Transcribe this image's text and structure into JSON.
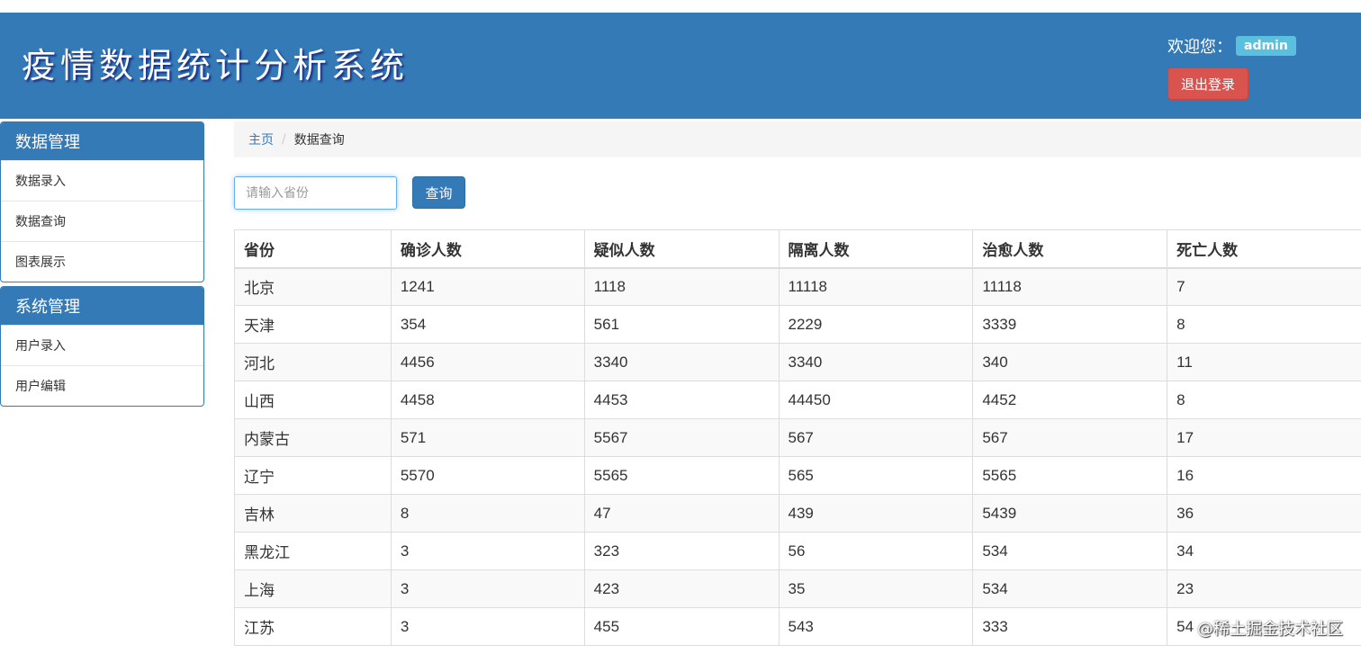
{
  "header": {
    "title": "疫情数据统计分析系统",
    "welcome_label": "欢迎您：",
    "username": "admin",
    "logout_label": "退出登录"
  },
  "sidebar": {
    "data_panel": {
      "title": "数据管理",
      "items": [
        "数据录入",
        "数据查询",
        "图表展示"
      ]
    },
    "system_panel": {
      "title": "系统管理",
      "items": [
        "用户录入",
        "用户编辑"
      ]
    }
  },
  "breadcrumb": {
    "home": "主页",
    "separator": "/",
    "current": "数据查询"
  },
  "search": {
    "placeholder": "请输入省份",
    "button_label": "查询"
  },
  "table": {
    "columns": [
      "省份",
      "确诊人数",
      "疑似人数",
      "隔离人数",
      "治愈人数",
      "死亡人数"
    ],
    "rows": [
      [
        "北京",
        "1241",
        "1118",
        "11118",
        "11118",
        "7"
      ],
      [
        "天津",
        "354",
        "561",
        "2229",
        "3339",
        "8"
      ],
      [
        "河北",
        "4456",
        "3340",
        "3340",
        "340",
        "11"
      ],
      [
        "山西",
        "4458",
        "4453",
        "44450",
        "4452",
        "8"
      ],
      [
        "内蒙古",
        "571",
        "5567",
        "567",
        "567",
        "17"
      ],
      [
        "辽宁",
        "5570",
        "5565",
        "565",
        "5565",
        "16"
      ],
      [
        "吉林",
        "8",
        "47",
        "439",
        "5439",
        "36"
      ],
      [
        "黑龙江",
        "3",
        "323",
        "56",
        "534",
        "34"
      ],
      [
        "上海",
        "3",
        "423",
        "35",
        "534",
        "23"
      ],
      [
        "江苏",
        "3",
        "455",
        "543",
        "333",
        "54"
      ]
    ]
  },
  "watermark": "@稀土掘金技术社区",
  "colors": {
    "primary": "#337ab7",
    "danger": "#d9534f",
    "info": "#5bc0de"
  }
}
